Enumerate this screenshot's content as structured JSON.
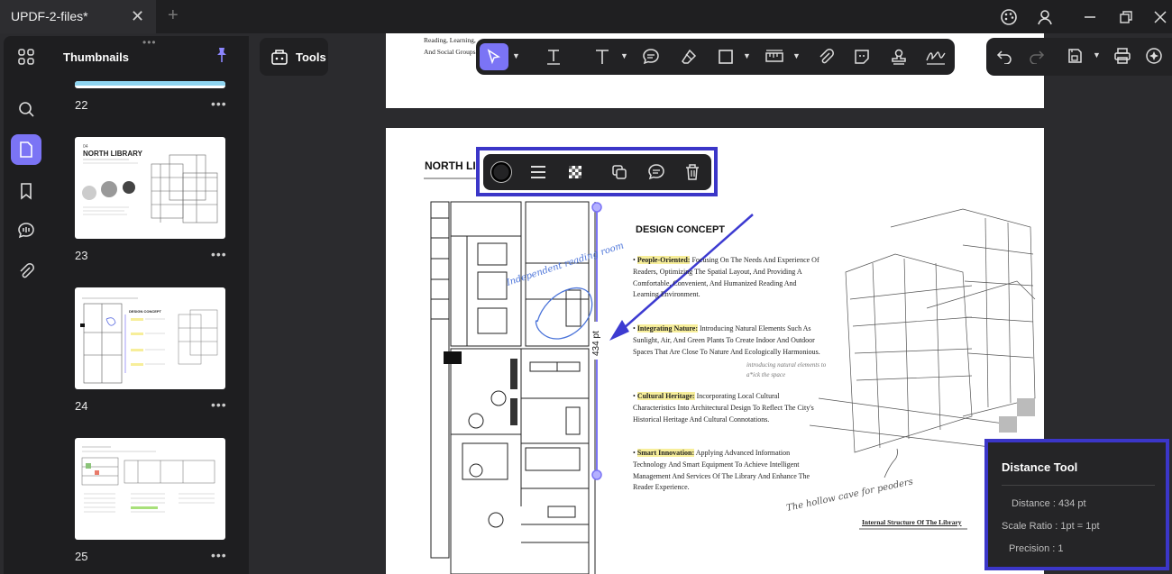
{
  "app": {
    "tab_title": "UPDF-2-files*",
    "new_tab_symbol": "+",
    "close_symbol": "✕"
  },
  "sidebar": {
    "panel_title": "Thumbnails",
    "thumbnails": [
      {
        "page": "22"
      },
      {
        "page": "23"
      },
      {
        "page": "24"
      },
      {
        "page": "25"
      }
    ],
    "more_symbol": "•••"
  },
  "tools": {
    "label": "Tools"
  },
  "page_top": {
    "lines": [
      "Reading, Learning,",
      "And Social Groups"
    ]
  },
  "page_main": {
    "title": "NORTH LI",
    "section_title": "DESIGN CONCEPT",
    "measure_label": "434 pt",
    "handwriting_1": "Independent reading room",
    "handwriting_2": "The hollow cave for peoders",
    "handwriting_3": "a cave",
    "bullets": [
      {
        "head": "People-Oriented:",
        "text": "Focusing On The Needs And Experience Of Readers, Optimizing The Spatial Layout, And Providing A Comfortable, Convenient, And Humanized Reading And Learning Environment."
      },
      {
        "head": "Integrating Nature:",
        "text": "Introducing Natural Elements Such As Sunlight, Air, And Green Plants To Create Indoor And Outdoor Spaces That Are Close To Nature And Ecologically Harmonious.",
        "note": "introducing natural elements to a*ick the space"
      },
      {
        "head": "Cultural Heritage:",
        "text": "Incorporating Local Cultural Characteristics Into Architectural Design To Reflect The City's Historical Heritage And Cultural Connotations."
      },
      {
        "head": "Smart Innovation:",
        "text": "Applying Advanced Information Technology And Smart Equipment To Achieve Intelligent Management And Services Of The Library And Enhance The Reader Experience."
      }
    ],
    "caption": "Internal Structure Of The Library"
  },
  "distance_tool": {
    "title": "Distance Tool",
    "distance": "Distance : 434 pt",
    "scale_ratio": "Scale Ratio : 1pt = 1pt",
    "precision": "Precision : 1"
  },
  "colors": {
    "accent": "#7b74f5",
    "frame": "#3b36c8",
    "highlight": "#f7ee9a",
    "ink": "#4a5fd6"
  }
}
